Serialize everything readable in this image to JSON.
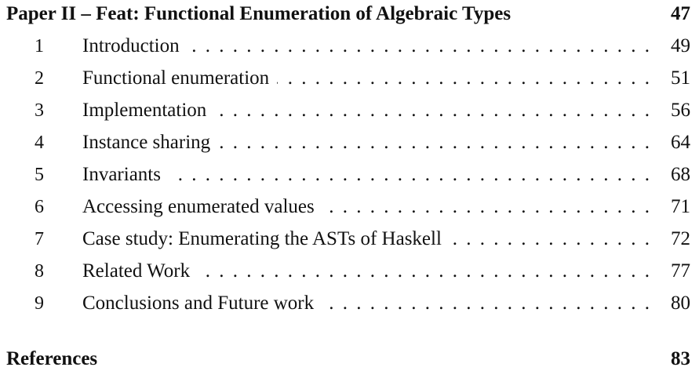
{
  "paper": {
    "title": "Paper II – Feat: Functional Enumeration of Algebraic Types",
    "page": "47"
  },
  "entries": [
    {
      "num": "1",
      "title": "Introduction",
      "page": "49"
    },
    {
      "num": "2",
      "title": "Functional enumeration",
      "page": "51"
    },
    {
      "num": "3",
      "title": "Implementation",
      "page": "56"
    },
    {
      "num": "4",
      "title": "Instance sharing",
      "page": "64"
    },
    {
      "num": "5",
      "title": "Invariants",
      "page": "68"
    },
    {
      "num": "6",
      "title": "Accessing enumerated values",
      "page": "71"
    },
    {
      "num": "7",
      "title": "Case study: Enumerating the ASTs of Haskell",
      "page": "72"
    },
    {
      "num": "8",
      "title": "Related Work",
      "page": "77"
    },
    {
      "num": "9",
      "title": "Conclusions and Future work",
      "page": "80"
    }
  ],
  "references": {
    "title": "References",
    "page": "83"
  }
}
